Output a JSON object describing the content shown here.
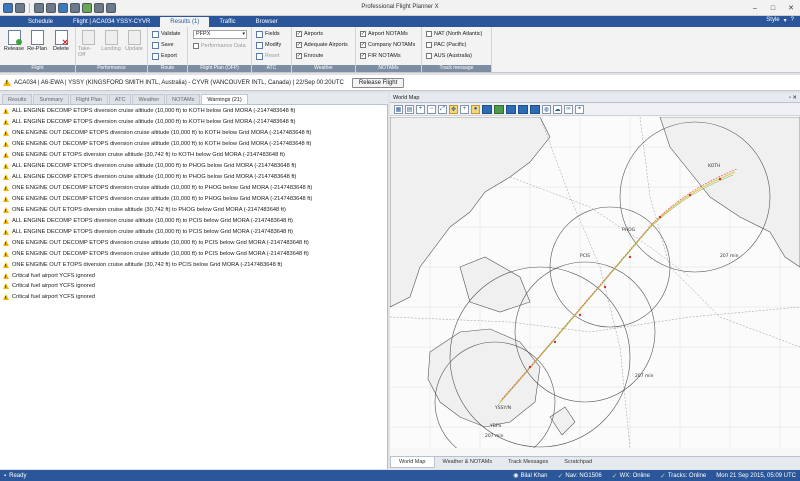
{
  "window": {
    "title": "Professional Flight Planner X"
  },
  "quick_access_icons": [
    "plane-icon",
    "dropdown-icon",
    "list-icon",
    "copy-icon",
    "save-icon",
    "document-icon",
    "chart-icon",
    "settings-icon",
    "refresh-icon"
  ],
  "tabs": [
    {
      "label": "Schedule"
    },
    {
      "label": "Flight | ACA034 YSSY-CYVR"
    },
    {
      "label": "Results (1)"
    },
    {
      "label": "Traffic"
    },
    {
      "label": "Browser"
    }
  ],
  "style_menu": {
    "label": "Style"
  },
  "ribbon": {
    "flight": {
      "label": "Flight",
      "release": "Release",
      "replan": "Re-Plan",
      "delete": "Delete"
    },
    "performance": {
      "label": "Performance",
      "takeoff": "Take-Off",
      "landing": "Landing",
      "update": "Update"
    },
    "route": {
      "label": "Route",
      "validate": "Validate",
      "save": "Save",
      "export": "Export"
    },
    "flight_plan_ofp": {
      "label": "Flight Plan (OFP)",
      "format_value": "PFPX",
      "performance_data": "Performance Data"
    },
    "atc": {
      "label": "ATC",
      "fields": "Fields",
      "modify": "Modify",
      "reset": "Reset"
    },
    "weather": {
      "label": "Weather",
      "airports": "Airports",
      "adequate_airports": "Adequate Airports",
      "enroute": "Enroute"
    },
    "notams": {
      "label": "NOTAMs",
      "airport_notams": "Airport NOTAMs",
      "company_notams": "Company NOTAMs",
      "fir_notams": "FIR NOTAMs"
    },
    "track_message": {
      "label": "Track message",
      "nat": "NAT (North Atlantic)",
      "pac": "PAC (Pacific)",
      "aus": "AUS (Australia)"
    }
  },
  "flight_info": {
    "text": "ACA034 | A6-EWA | YSSY (KINGSFORD SMITH INTL, Australia) - CYVR (VANCOUVER INTL, Canada) | 22/Sep 00:20UTC",
    "release_button": "Release Flight"
  },
  "left_tabs": [
    {
      "label": "Results"
    },
    {
      "label": "Summary"
    },
    {
      "label": "Flight Plan"
    },
    {
      "label": "ATC"
    },
    {
      "label": "Weather"
    },
    {
      "label": "NOTAMs"
    },
    {
      "label": "Warnings (21)"
    }
  ],
  "warnings": [
    "ALL ENGINE DECOMP ETOPS diversion cruise altitude (10,000 ft) to KOTH below Grid MORA (-2147483648 ft)",
    "ALL ENGINE DECOMP ETOPS diversion cruise altitude (10,000 ft) to KOTH below Grid MORA (-2147483648 ft)",
    "ONE ENGINE OUT DECOMP ETOPS diversion cruise altitude (10,000 ft) to KOTH below Grid MORA (-2147483648 ft)",
    "ONE ENGINE OUT DECOMP ETOPS diversion cruise altitude (10,000 ft) to KOTH below Grid MORA (-2147483648 ft)",
    "ONE ENGINE OUT ETOPS diversion cruise altitude (30,742 ft) to KOTH below Grid MORA (-2147483648 ft)",
    "ALL ENGINE DECOMP ETOPS diversion cruise altitude (10,000 ft) to PHOG below Grid MORA (-2147483648 ft)",
    "ALL ENGINE DECOMP ETOPS diversion cruise altitude (10,000 ft) to PHOG below Grid MORA (-2147483648 ft)",
    "ONE ENGINE OUT DECOMP ETOPS diversion cruise altitude (10,000 ft) to PHOG below Grid MORA (-2147483648 ft)",
    "ONE ENGINE OUT DECOMP ETOPS diversion cruise altitude (10,000 ft) to PHOG below Grid MORA (-2147483648 ft)",
    "ONE ENGINE OUT ETOPS diversion cruise altitude (30,742 ft) to PHOG below Grid MORA (-2147483648 ft)",
    "ALL ENGINE DECOMP ETOPS diversion cruise altitude (10,000 ft) to PCIS below Grid MORA (-2147483648 ft)",
    "ALL ENGINE DECOMP ETOPS diversion cruise altitude (10,000 ft) to PCIS below Grid MORA (-2147483648 ft)",
    "ONE ENGINE OUT DECOMP ETOPS diversion cruise altitude (10,000 ft) to PCIS below Grid MORA (-2147483648 ft)",
    "ONE ENGINE OUT DECOMP ETOPS diversion cruise altitude (10,000 ft) to PCIS below Grid MORA (-2147483648 ft)",
    "ONE ENGINE OUT ETOPS diversion cruise altitude (30,742 ft) to PCIS below Grid MORA (-2147483648 ft)",
    "Critical fuel airport YCFS ignored",
    "Critical fuel airport YCFS ignored",
    "Critical fuel airport YCFS ignored"
  ],
  "map": {
    "title": "World Map",
    "labels": [
      "PHOG",
      "PCIS",
      "YSSY/N",
      "KOTH",
      "207 min",
      "207 min",
      "207 min",
      "YBFS"
    ]
  },
  "bottom_tabs": [
    {
      "label": "World Map"
    },
    {
      "label": "Weather & NOTAMs"
    },
    {
      "label": "Track Messages"
    },
    {
      "label": "Scratchpad"
    }
  ],
  "status": {
    "ready": "Ready",
    "user": "Bilal Khan",
    "nav": "Nav: NG1506",
    "wx": "WX: Online",
    "tracks": "Tracks: Online",
    "datetime": "Mon 21 Sep 2015, 05:09 UTC"
  }
}
